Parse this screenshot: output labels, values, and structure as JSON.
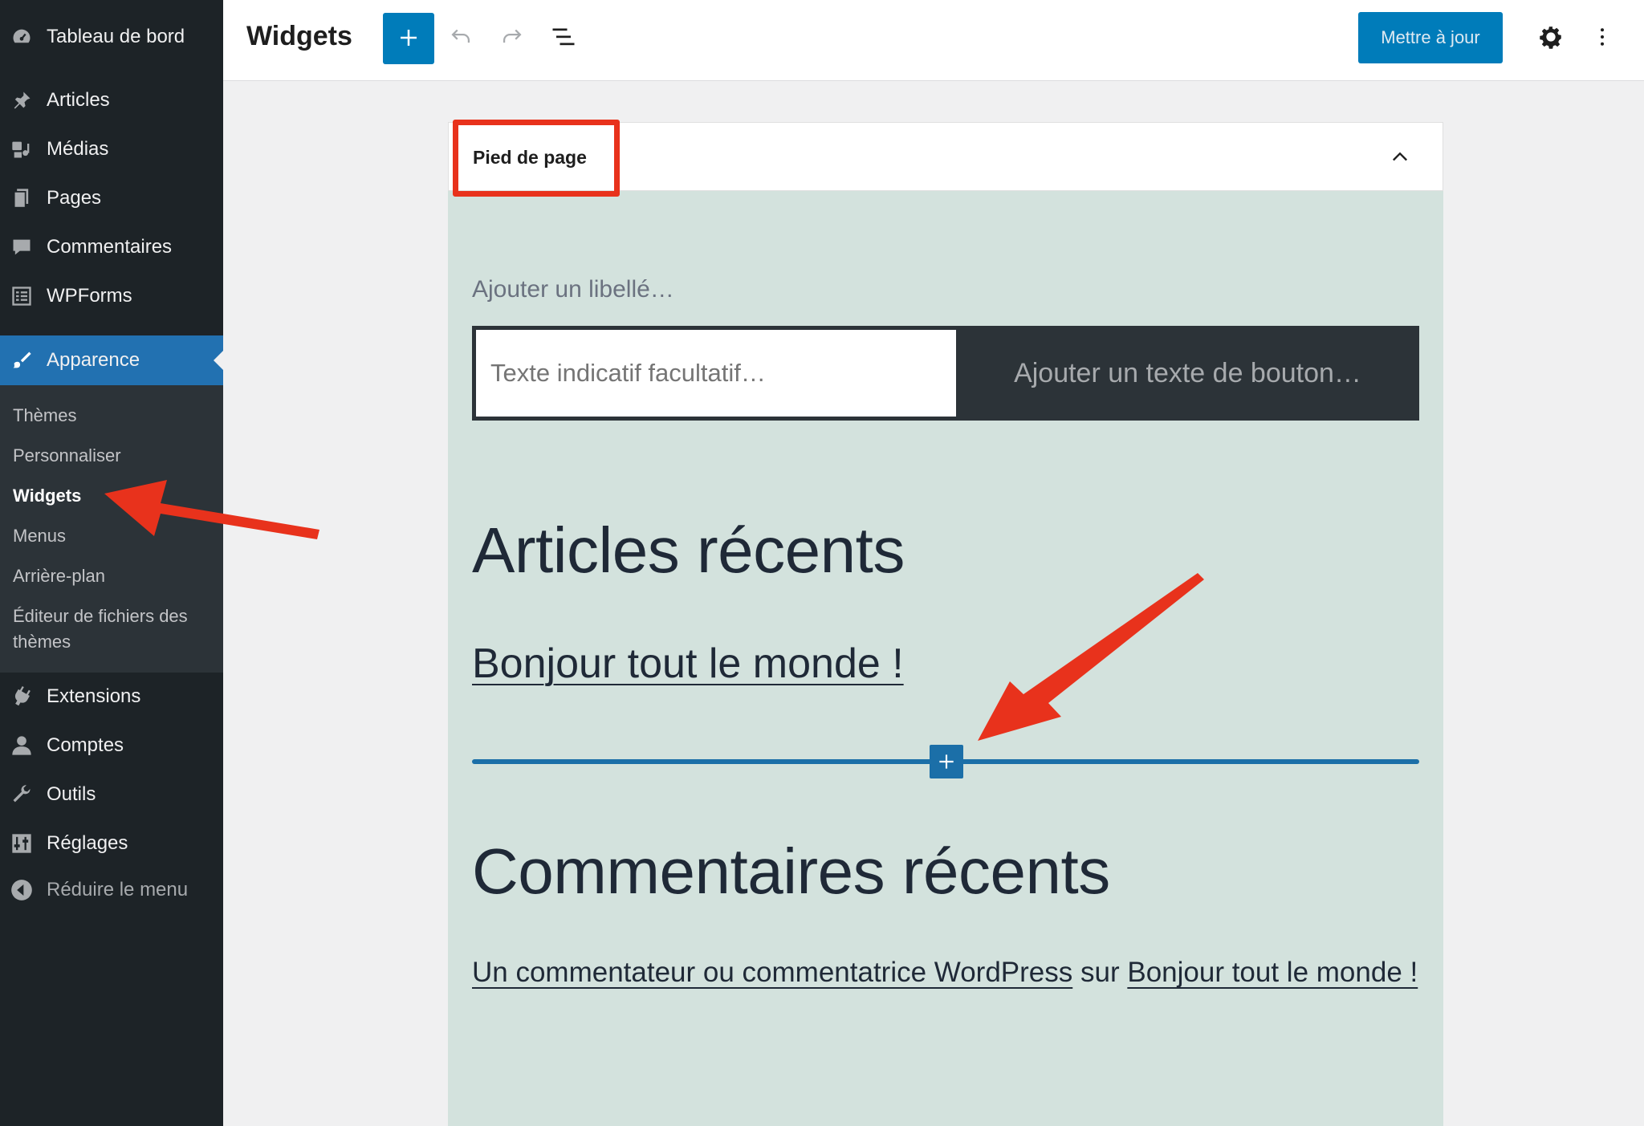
{
  "sidebar": {
    "items": [
      {
        "label": "Tableau de bord",
        "icon": "dashboard-icon"
      },
      {
        "label": "Articles",
        "icon": "pin-icon"
      },
      {
        "label": "Médias",
        "icon": "media-icon"
      },
      {
        "label": "Pages",
        "icon": "pages-icon"
      },
      {
        "label": "Commentaires",
        "icon": "comment-icon"
      },
      {
        "label": "WPForms",
        "icon": "form-icon"
      },
      {
        "label": "Apparence",
        "icon": "paintbrush-icon"
      },
      {
        "label": "Extensions",
        "icon": "plugin-icon"
      },
      {
        "label": "Comptes",
        "icon": "user-icon"
      },
      {
        "label": "Outils",
        "icon": "wrench-icon"
      },
      {
        "label": "Réglages",
        "icon": "settings-sliders-icon"
      }
    ],
    "submenu": [
      "Thèmes",
      "Personnaliser",
      "Widgets",
      "Menus",
      "Arrière-plan",
      "Éditeur de fichiers des",
      "thèmes"
    ],
    "collapse_label": "Réduire le menu"
  },
  "header": {
    "title": "Widgets",
    "update_button": "Mettre à jour"
  },
  "widget_area": {
    "title": "Pied de page",
    "label_placeholder": "Ajouter un libellé…",
    "search_placeholder": "Texte indicatif facultatif…",
    "search_button": "Ajouter un texte de bouton…",
    "recent_posts_heading": "Articles récents",
    "recent_post": "Bonjour tout le monde !",
    "recent_comments_heading": "Commentaires récents",
    "comment": {
      "author": "Un commentateur ou commentatrice WordPress",
      "sep": "sur",
      "post": "Bonjour tout le monde !"
    }
  },
  "colors": {
    "sidebar_bg": "#1d2327",
    "accent": "#2271b1",
    "primary_button": "#007cba",
    "canvas_bg": "#d3e2dd",
    "annotation": "#e8321c"
  }
}
